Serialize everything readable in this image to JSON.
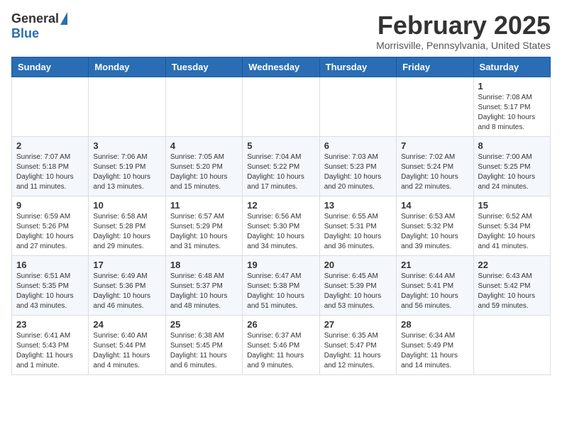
{
  "header": {
    "logo_general": "General",
    "logo_blue": "Blue",
    "month_title": "February 2025",
    "location": "Morrisville, Pennsylvania, United States"
  },
  "weekdays": [
    "Sunday",
    "Monday",
    "Tuesday",
    "Wednesday",
    "Thursday",
    "Friday",
    "Saturday"
  ],
  "weeks": [
    [
      {
        "day": "",
        "info": ""
      },
      {
        "day": "",
        "info": ""
      },
      {
        "day": "",
        "info": ""
      },
      {
        "day": "",
        "info": ""
      },
      {
        "day": "",
        "info": ""
      },
      {
        "day": "",
        "info": ""
      },
      {
        "day": "1",
        "info": "Sunrise: 7:08 AM\nSunset: 5:17 PM\nDaylight: 10 hours\nand 8 minutes."
      }
    ],
    [
      {
        "day": "2",
        "info": "Sunrise: 7:07 AM\nSunset: 5:18 PM\nDaylight: 10 hours\nand 11 minutes."
      },
      {
        "day": "3",
        "info": "Sunrise: 7:06 AM\nSunset: 5:19 PM\nDaylight: 10 hours\nand 13 minutes."
      },
      {
        "day": "4",
        "info": "Sunrise: 7:05 AM\nSunset: 5:20 PM\nDaylight: 10 hours\nand 15 minutes."
      },
      {
        "day": "5",
        "info": "Sunrise: 7:04 AM\nSunset: 5:22 PM\nDaylight: 10 hours\nand 17 minutes."
      },
      {
        "day": "6",
        "info": "Sunrise: 7:03 AM\nSunset: 5:23 PM\nDaylight: 10 hours\nand 20 minutes."
      },
      {
        "day": "7",
        "info": "Sunrise: 7:02 AM\nSunset: 5:24 PM\nDaylight: 10 hours\nand 22 minutes."
      },
      {
        "day": "8",
        "info": "Sunrise: 7:00 AM\nSunset: 5:25 PM\nDaylight: 10 hours\nand 24 minutes."
      }
    ],
    [
      {
        "day": "9",
        "info": "Sunrise: 6:59 AM\nSunset: 5:26 PM\nDaylight: 10 hours\nand 27 minutes."
      },
      {
        "day": "10",
        "info": "Sunrise: 6:58 AM\nSunset: 5:28 PM\nDaylight: 10 hours\nand 29 minutes."
      },
      {
        "day": "11",
        "info": "Sunrise: 6:57 AM\nSunset: 5:29 PM\nDaylight: 10 hours\nand 31 minutes."
      },
      {
        "day": "12",
        "info": "Sunrise: 6:56 AM\nSunset: 5:30 PM\nDaylight: 10 hours\nand 34 minutes."
      },
      {
        "day": "13",
        "info": "Sunrise: 6:55 AM\nSunset: 5:31 PM\nDaylight: 10 hours\nand 36 minutes."
      },
      {
        "day": "14",
        "info": "Sunrise: 6:53 AM\nSunset: 5:32 PM\nDaylight: 10 hours\nand 39 minutes."
      },
      {
        "day": "15",
        "info": "Sunrise: 6:52 AM\nSunset: 5:34 PM\nDaylight: 10 hours\nand 41 minutes."
      }
    ],
    [
      {
        "day": "16",
        "info": "Sunrise: 6:51 AM\nSunset: 5:35 PM\nDaylight: 10 hours\nand 43 minutes."
      },
      {
        "day": "17",
        "info": "Sunrise: 6:49 AM\nSunset: 5:36 PM\nDaylight: 10 hours\nand 46 minutes."
      },
      {
        "day": "18",
        "info": "Sunrise: 6:48 AM\nSunset: 5:37 PM\nDaylight: 10 hours\nand 48 minutes."
      },
      {
        "day": "19",
        "info": "Sunrise: 6:47 AM\nSunset: 5:38 PM\nDaylight: 10 hours\nand 51 minutes."
      },
      {
        "day": "20",
        "info": "Sunrise: 6:45 AM\nSunset: 5:39 PM\nDaylight: 10 hours\nand 53 minutes."
      },
      {
        "day": "21",
        "info": "Sunrise: 6:44 AM\nSunset: 5:41 PM\nDaylight: 10 hours\nand 56 minutes."
      },
      {
        "day": "22",
        "info": "Sunrise: 6:43 AM\nSunset: 5:42 PM\nDaylight: 10 hours\nand 59 minutes."
      }
    ],
    [
      {
        "day": "23",
        "info": "Sunrise: 6:41 AM\nSunset: 5:43 PM\nDaylight: 11 hours\nand 1 minute."
      },
      {
        "day": "24",
        "info": "Sunrise: 6:40 AM\nSunset: 5:44 PM\nDaylight: 11 hours\nand 4 minutes."
      },
      {
        "day": "25",
        "info": "Sunrise: 6:38 AM\nSunset: 5:45 PM\nDaylight: 11 hours\nand 6 minutes."
      },
      {
        "day": "26",
        "info": "Sunrise: 6:37 AM\nSunset: 5:46 PM\nDaylight: 11 hours\nand 9 minutes."
      },
      {
        "day": "27",
        "info": "Sunrise: 6:35 AM\nSunset: 5:47 PM\nDaylight: 11 hours\nand 12 minutes."
      },
      {
        "day": "28",
        "info": "Sunrise: 6:34 AM\nSunset: 5:49 PM\nDaylight: 11 hours\nand 14 minutes."
      },
      {
        "day": "",
        "info": ""
      }
    ]
  ]
}
